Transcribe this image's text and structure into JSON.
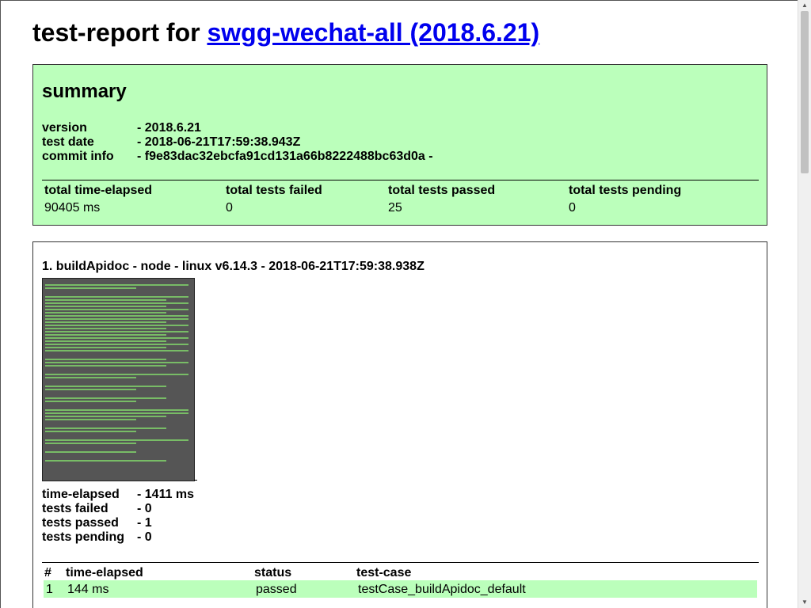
{
  "header": {
    "title_prefix": "test-report for ",
    "title_link": "swgg-wechat-all (2018.6.21)"
  },
  "summary": {
    "heading": "summary",
    "version_label": "version",
    "version_value": "- 2018.6.21",
    "date_label": "test date",
    "date_value": "- 2018-06-21T17:59:38.943Z",
    "commit_label": "commit info",
    "commit_value": "- f9e83dac32ebcfa91cd131a66b8222488bc63d0a -",
    "columns": [
      "total time-elapsed",
      "total tests failed",
      "total tests passed",
      "total tests pending"
    ],
    "values": [
      "90405 ms",
      "0",
      "25",
      "0"
    ]
  },
  "detail": {
    "heading": "1. buildApidoc - node - linux v6.14.3 - 2018-06-21T17:59:38.938Z",
    "screenshot_alt": "buildApidoc terminal screenshot",
    "stats": [
      {
        "label": "time-elapsed",
        "value": "- 1411 ms"
      },
      {
        "label": "tests failed",
        "value": "- 0"
      },
      {
        "label": "tests passed",
        "value": "- 1"
      },
      {
        "label": "tests pending",
        "value": "- 0"
      }
    ],
    "case_columns": [
      "#",
      "time-elapsed",
      "status",
      "test-case"
    ],
    "cases": [
      {
        "num": "1",
        "time": "144 ms",
        "status": "passed",
        "name": "testCase_buildApidoc_default"
      }
    ]
  },
  "colors": {
    "pass_bg": "#bbffbb",
    "link": "#0000ee"
  }
}
